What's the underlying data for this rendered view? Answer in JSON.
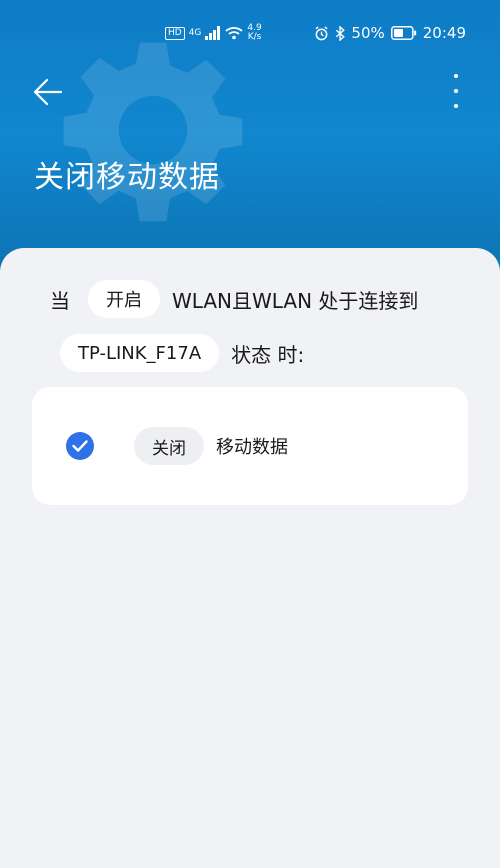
{
  "status_bar": {
    "hd": "HD",
    "network": "4G",
    "speed_top": "4.9",
    "speed_bottom": "K/s",
    "battery": "50%",
    "time": "20:49"
  },
  "header": {
    "title": "关闭移动数据"
  },
  "condition": {
    "prefix": "当",
    "toggle_label": "开启",
    "wlan_text": "WLAN且WLAN 处于连接到",
    "network_name": "TP-LINK_F17A",
    "state_text": "状态 时:"
  },
  "action": {
    "checked": true,
    "action_label": "关闭",
    "target_text": "移动数据"
  },
  "colors": {
    "header_blue": "#1187cf",
    "accent_blue": "#2f71e8",
    "background": "#f1f2f6"
  }
}
